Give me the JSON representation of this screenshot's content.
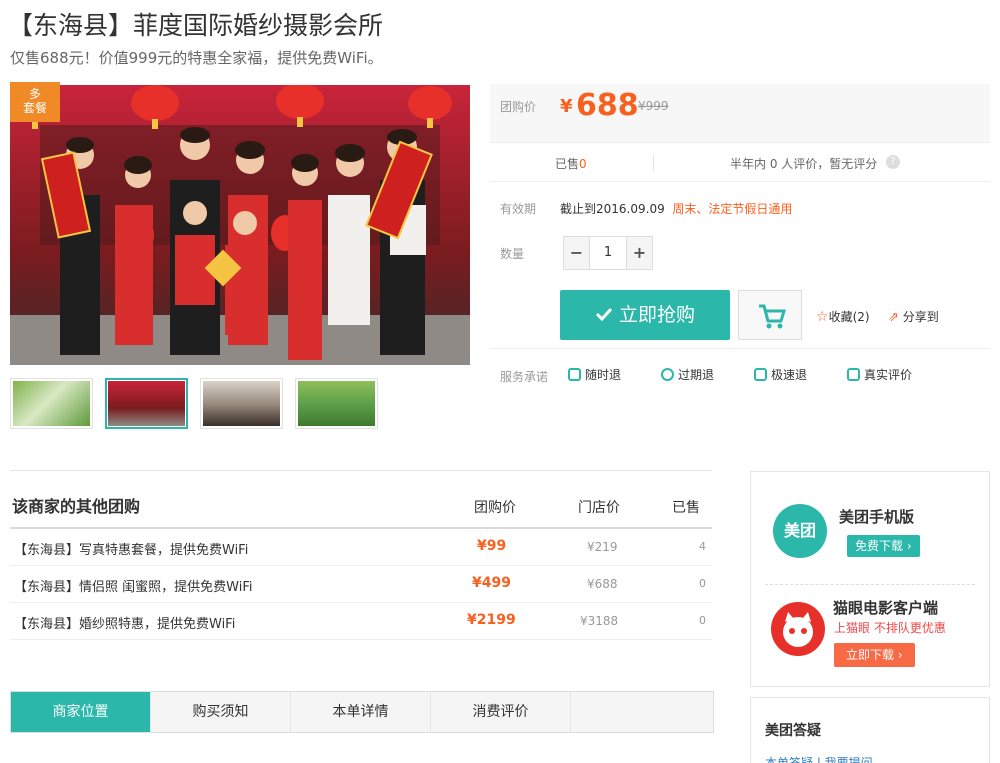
{
  "header": {
    "title": "【东海县】菲度国际婚纱摄影会所",
    "subtitle": "仅售688元！价值999元的特惠全家福，提供免费WiFi。"
  },
  "gallery": {
    "badge": "多\n套餐",
    "thumbnails": [
      "thumb-1",
      "thumb-2",
      "thumb-3",
      "thumb-4"
    ],
    "active_index": 1
  },
  "deal": {
    "price_label": "团购价",
    "currency": "¥",
    "price": "688",
    "original_price": "¥999",
    "sold_prefix": "已售",
    "sold_count": "0",
    "reviews_text": "半年内 0 人评价，暂无评分",
    "help_icon": "?",
    "validity_label": "有效期",
    "validity_text": "截止到2016.09.09",
    "validity_tag": "周末、法定节假日通用",
    "quantity_label": "数量",
    "quantity": "1",
    "minus": "−",
    "plus": "+",
    "buy_label": "立即抢购",
    "favorite_label": "收藏(2)",
    "share_label": "分享到",
    "service_label": "服务承诺",
    "services": [
      "随时退",
      "过期退",
      "极速退",
      "真实评价"
    ]
  },
  "others": {
    "title": "该商家的其他团购",
    "col_price": "团购价",
    "col_store": "门店价",
    "col_sold": "已售",
    "rows": [
      {
        "name": "【东海县】写真特惠套餐，提供免费WiFi",
        "price": "¥99",
        "store": "¥219",
        "sold": "4"
      },
      {
        "name": "【东海县】情侣照 闺蜜照，提供免费WiFi",
        "price": "¥499",
        "store": "¥688",
        "sold": "0"
      },
      {
        "name": "【东海县】婚纱照特惠，提供免费WiFi",
        "price": "¥2199",
        "store": "¥3188",
        "sold": "0"
      }
    ]
  },
  "tabs": [
    "商家位置",
    "购买须知",
    "本单详情",
    "消费评价"
  ],
  "apps": {
    "meituan": {
      "logo_text": "美团",
      "name": "美团手机版",
      "button": "免费下载 ›"
    },
    "maoyan": {
      "name": "猫眼电影客户端",
      "slogan": "上猫眼 不排队更优惠",
      "button": "立即下载 ›"
    }
  },
  "qa": {
    "title": "美团答疑",
    "links": "本单答疑 | 我要提问"
  },
  "colors": {
    "accent": "#2bb8aa",
    "price": "#f76120",
    "badge": "#f08a27"
  }
}
